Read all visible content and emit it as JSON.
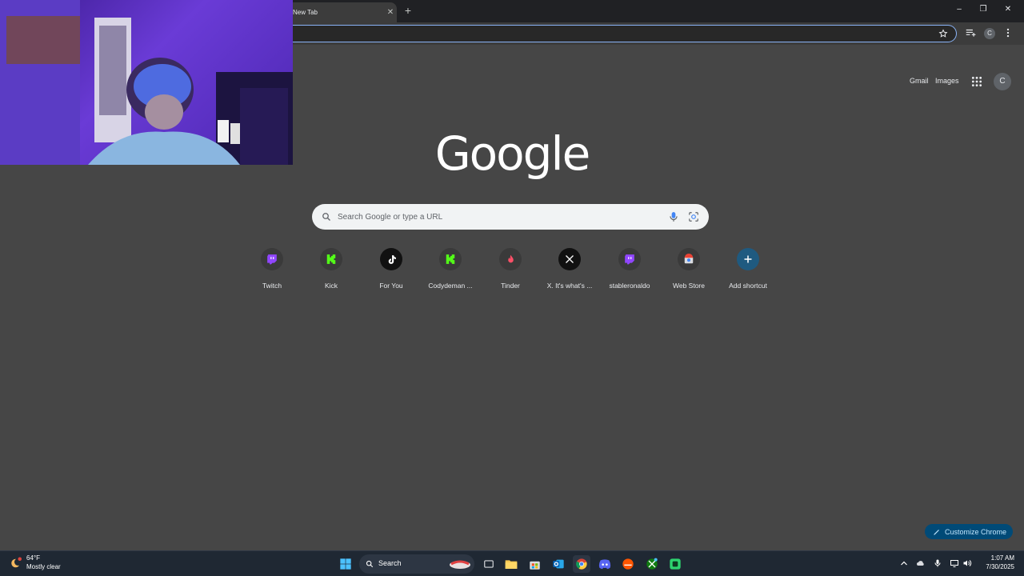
{
  "tab": {
    "title": "New Tab"
  },
  "header": {
    "gmail": "Gmail",
    "images": "Images",
    "avatar_initial": "C"
  },
  "toolbar": {
    "avatar_initial": "C"
  },
  "logo": "Google",
  "search": {
    "placeholder": "Search Google or type a URL"
  },
  "shortcuts": [
    {
      "label": "Twitch",
      "icon": "twitch-icon"
    },
    {
      "label": "Kick",
      "icon": "kick-icon"
    },
    {
      "label": "For You",
      "icon": "tiktok-icon"
    },
    {
      "label": "Codydeman ...",
      "icon": "kick-icon"
    },
    {
      "label": "Tinder",
      "icon": "tinder-icon"
    },
    {
      "label": "X. It's what's ...",
      "icon": "x-icon"
    },
    {
      "label": "stableronaldo",
      "icon": "twitch-icon"
    },
    {
      "label": "Web Store",
      "icon": "web-store-icon"
    },
    {
      "label": "Add shortcut",
      "icon": "plus-icon"
    }
  ],
  "customize": {
    "label": "Customize Chrome"
  },
  "taskbar": {
    "weather_temp": "64°F",
    "weather_desc": "Mostly clear",
    "search_label": "Search",
    "time": "1:07 AM",
    "date": "7/30/2025"
  },
  "colors": {
    "accent": "#8ab4f8",
    "customize_bg": "#004a77",
    "twitch": "#9146ff",
    "kick": "#53fc18",
    "tinder": "#fd5068"
  }
}
